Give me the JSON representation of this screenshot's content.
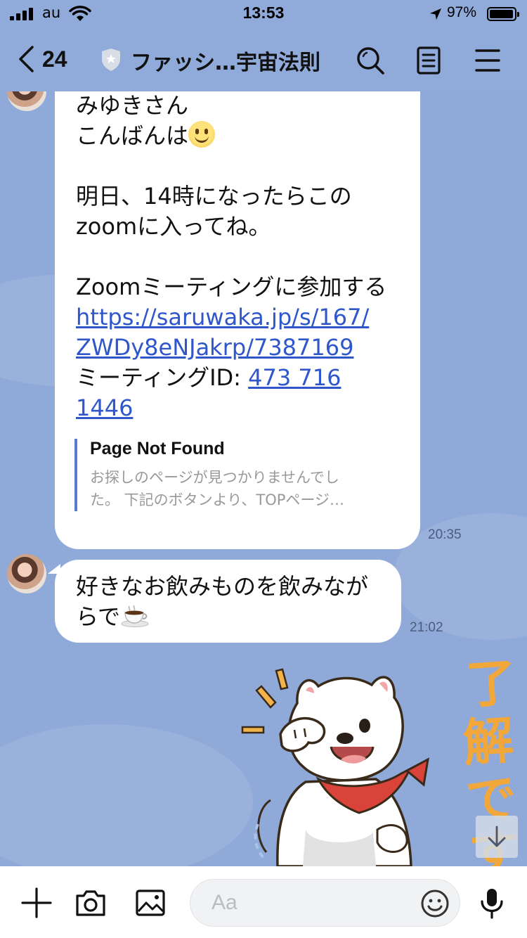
{
  "status_bar": {
    "carrier": "au",
    "time": "13:53",
    "battery_percent": "97%",
    "battery_level": 0.97
  },
  "header": {
    "back_count": "24",
    "title": "ファッシ…宇宙法則",
    "icons": [
      "search-icon",
      "notes-icon",
      "menu-icon"
    ]
  },
  "messages": [
    {
      "greeting": "みゆきさん\nこんばんは",
      "body": "明日、14時になったらこの\nzoomに入ってね。",
      "zoom_label": "Zoomミーティングに参加する",
      "link_line1": "https://saruwaka.jp/s/167/",
      "link_line2": "ZWDy8eNJakrp/7387169",
      "meeting_id_label": "ミーティングID: ",
      "meeting_id_part1": "473 716",
      "meeting_id_part2": "1446",
      "preview_title": "Page Not Found",
      "preview_desc": "お探しのページが見つかりませんでし\nた。 下記のボタンより、TOPページ…",
      "time": "20:35"
    },
    {
      "text": "好きなお飲みものを飲みなが\nらで",
      "time": "21:02"
    }
  ],
  "sticker": {
    "caption": "了解です"
  },
  "input_bar": {
    "placeholder": "Aa"
  },
  "colors": {
    "chat_background": "#8fa9d8",
    "link": "#2f57c9",
    "preview_bar": "#5a79d2",
    "bandana": "#d9433a",
    "sticker_text": "#f2a73b"
  }
}
